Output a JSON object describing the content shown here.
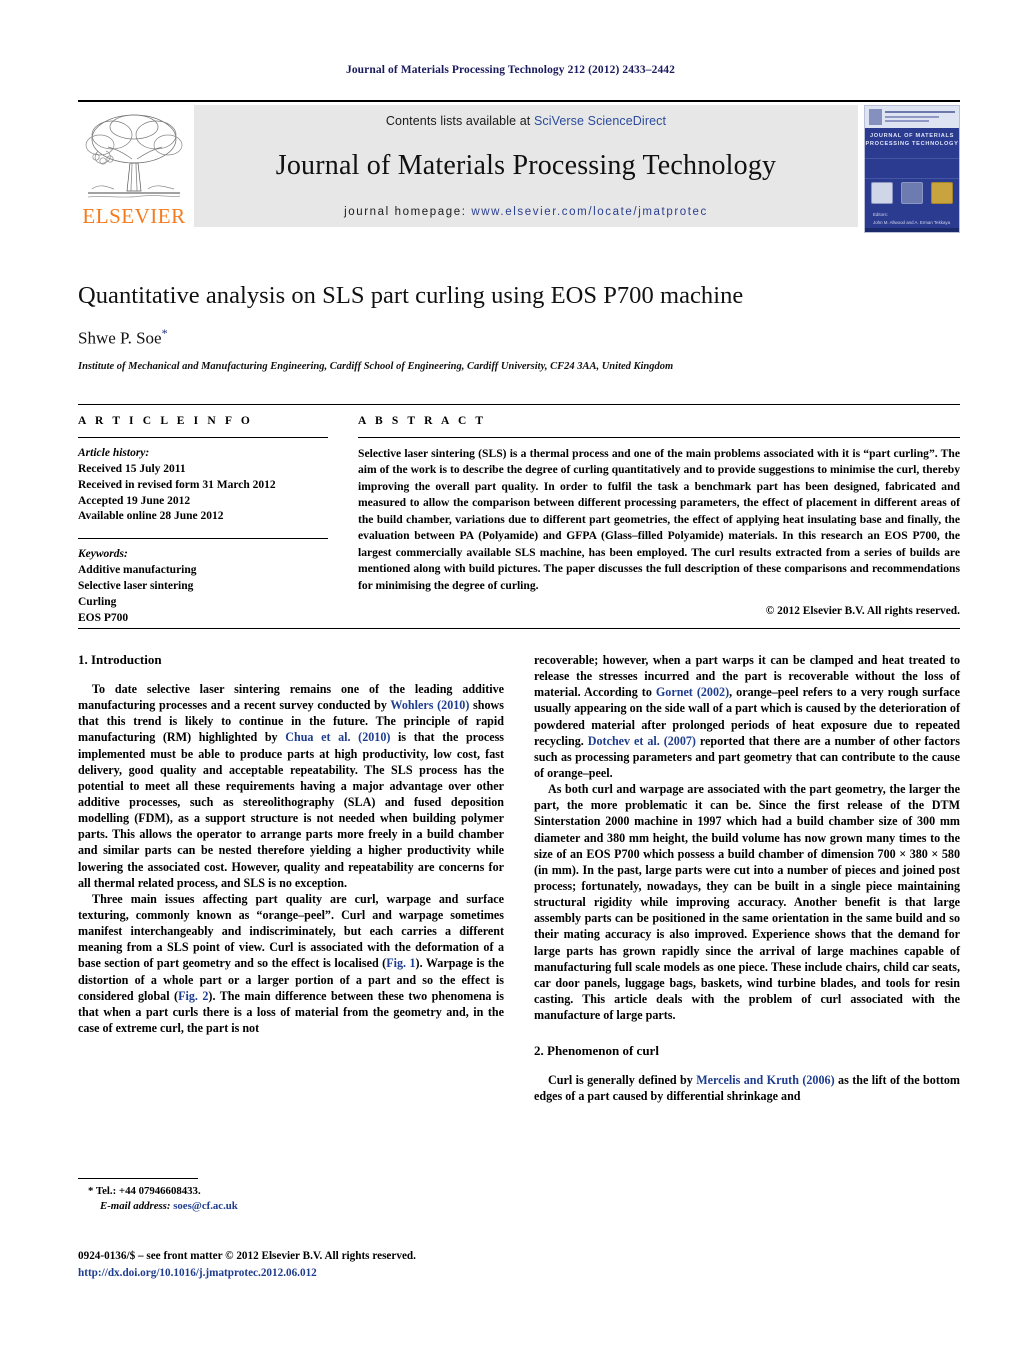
{
  "running_head": "Journal of Materials Processing Technology 212 (2012) 2433–2442",
  "masthead": {
    "publisher_name": "ELSEVIER",
    "contents_prefix": "Contents lists available at ",
    "contents_link": "SciVerse ScienceDirect",
    "journal_title": "Journal of Materials Processing Technology",
    "homepage_prefix": "journal homepage:",
    "homepage_link": "www.elsevier.com/locate/jmatprotec",
    "cover": {
      "journal_name_line1": "JOURNAL OF MATERIALS",
      "journal_name_line2": "PROCESSING TECHNOLOGY",
      "editor_line1": "Editors:",
      "editor_line2": "John M. Allwood and A. Erman Tekkaya"
    }
  },
  "title_block": {
    "title": "Quantitative analysis on SLS part curling using EOS P700 machine",
    "author": "Shwe P. Soe",
    "corresponding_marker": "*",
    "affiliation": "Institute of Mechanical and Manufacturing Engineering, Cardiff School of Engineering, Cardiff University, CF24 3AA, United Kingdom"
  },
  "article_info": {
    "heading": "A R T I C L E    I N F O",
    "history_label": "Article history:",
    "history": [
      "Received 15 July 2011",
      "Received in revised form 31 March 2012",
      "Accepted 19 June 2012",
      "Available online 28 June 2012"
    ],
    "keywords_label": "Keywords:",
    "keywords": [
      "Additive manufacturing",
      "Selective laser sintering",
      "Curling",
      "EOS P700"
    ]
  },
  "abstract": {
    "heading": "A B S T R A C T",
    "text": "Selective laser sintering (SLS) is a thermal process and one of the main problems associated with it is “part curling”. The aim of the work is to describe the degree of curling quantitatively and to provide suggestions to minimise the curl, thereby improving the overall part quality. In order to fulfil the task a benchmark part has been designed, fabricated and measured to allow the comparison between different processing parameters, the effect of placement in different areas of the build chamber, variations due to different part geometries, the effect of applying heat insulating base and finally, the evaluation between PA (Polyamide) and GFPA (Glass–filled Polyamide) materials. In this research an EOS P700, the largest commercially available SLS machine, has been employed. The curl results extracted from a series of builds are mentioned along with build pictures. The paper discusses the full description of these comparisons and recommendations for minimising the degree of curling.",
    "copyright": "© 2012 Elsevier B.V. All rights reserved."
  },
  "body": {
    "section1_heading": "1.  Introduction",
    "left_p1_a": "To date selective laser sintering remains one of the leading additive manufacturing processes and a recent survey conducted by ",
    "left_p1_cite1": "Wohlers (2010)",
    "left_p1_b": " shows that this trend is likely to continue in the future. The principle of rapid manufacturing (RM) highlighted by ",
    "left_p1_cite2": "Chua et al. (2010)",
    "left_p1_c": " is that the process implemented must be able to produce parts at high productivity, low cost, fast delivery, good quality and acceptable repeatability. The SLS process has the potential to meet all these requirements having a major advantage over other additive processes, such as stereolithography (SLA) and fused deposition modelling (FDM), as a support structure is not needed when building polymer parts. This allows the operator to arrange parts more freely in a build chamber and similar parts can be nested therefore yielding a higher productivity while lowering the associated cost. However, quality and repeatability are concerns for all thermal related process, and SLS is no exception.",
    "left_p2_a": "Three main issues affecting part quality are curl, warpage and surface texturing, commonly known as “orange–peel”. Curl and warpage sometimes manifest interchangeably and indiscriminately, but each carries a different meaning from a SLS point of view. Curl is associated with the deformation of a base section of part geometry and so the effect is localised (",
    "left_p2_cite1": "Fig. 1",
    "left_p2_b": "). Warpage is the distortion of a whole part or a larger portion of a part and so the effect is considered global (",
    "left_p2_cite2": "Fig. 2",
    "left_p2_c": "). The main difference between these two phenomena is that when a part curls there is a loss of material from the geometry and, in the case of extreme curl, the part is not",
    "right_p1_a": "recoverable; however, when a part warps it can be clamped and heat treated to release the stresses incurred and the part is recoverable without the loss of material. According to ",
    "right_p1_cite1": "Gornet (2002)",
    "right_p1_b": ", orange–peel refers to a very rough surface usually appearing on the side wall of a part which is caused by the deterioration of powdered material after prolonged periods of heat exposure due to repeated recycling. ",
    "right_p1_cite2": "Dotchev et al. (2007)",
    "right_p1_c": " reported that there are a number of other factors such as processing parameters and part geometry that can contribute to the cause of orange–peel.",
    "right_p2": "As both curl and warpage are associated with the part geometry, the larger the part, the more problematic it can be. Since the first release of the DTM Sinterstation 2000 machine in 1997 which had a build chamber size of 300 mm diameter and 380 mm height, the build volume has now grown many times to the size of an EOS P700 which possess a build chamber of dimension 700 × 380 × 580 (in mm). In the past, large parts were cut into a number of pieces and joined post process; fortunately, nowadays, they can be built in a single piece maintaining structural rigidity while improving accuracy. Another benefit is that large assembly parts can be positioned in the same orientation in the same build and so their mating accuracy is also improved. Experience shows that the demand for large parts has grown rapidly since the arrival of large machines capable of manufacturing full scale models as one piece. These include chairs, child car seats, car door panels, luggage bags, baskets, wind turbine blades, and tools for resin casting. This article deals with the problem of curl associated with the manufacture of large parts.",
    "section2_heading": "2.  Phenomenon of curl",
    "right_p3_a": "Curl is generally defined by ",
    "right_p3_cite1": "Mercelis and Kruth (2006)",
    "right_p3_b": " as the lift of the bottom edges of a part caused by differential shrinkage and"
  },
  "footer": {
    "tel_marker": "*",
    "tel": "Tel.: +44 07946608433.",
    "email_label": "E-mail address:",
    "email": "soes@cf.ac.uk",
    "issn_line": "0924-0136/$ – see front matter © 2012 Elsevier B.V. All rights reserved.",
    "doi": "http://dx.doi.org/10.1016/j.jmatprotec.2012.06.012"
  },
  "colors": {
    "link": "#1f3d8f",
    "elsevier_orange": "#F47B20",
    "running_head": "#1a1a5e",
    "masthead_bg": "#e7e7e7"
  }
}
